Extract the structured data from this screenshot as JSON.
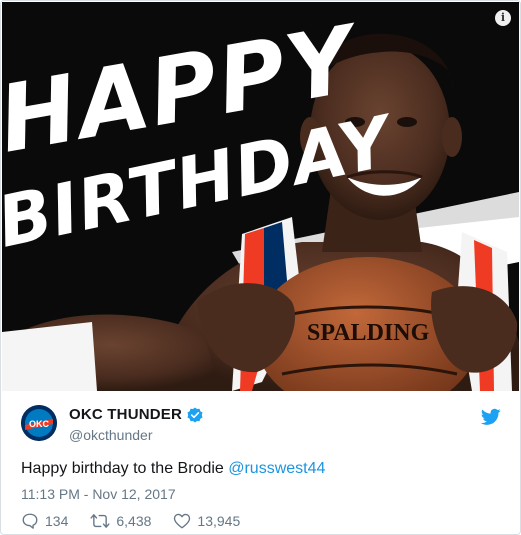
{
  "image": {
    "overlay_line1": "HAPPY",
    "overlay_line2": "BIRTHDAY",
    "ball_text": "SPALDING",
    "info_label": "i"
  },
  "account": {
    "name": "OKC THUNDER",
    "handle": "@okcthunder",
    "logo_text": "OKC",
    "verified": true
  },
  "tweet": {
    "text": "Happy birthday to the Brodie ",
    "mention": "@russwest44",
    "timestamp": "11:13 PM - Nov 12, 2017"
  },
  "stats": {
    "replies": "134",
    "retweets": "6,438",
    "likes": "13,945"
  },
  "colors": {
    "twitter_blue": "#1da1f2",
    "link": "#1b95e0",
    "muted": "#657786",
    "thunder_orange": "#ef3b24",
    "thunder_navy": "#002d62"
  }
}
